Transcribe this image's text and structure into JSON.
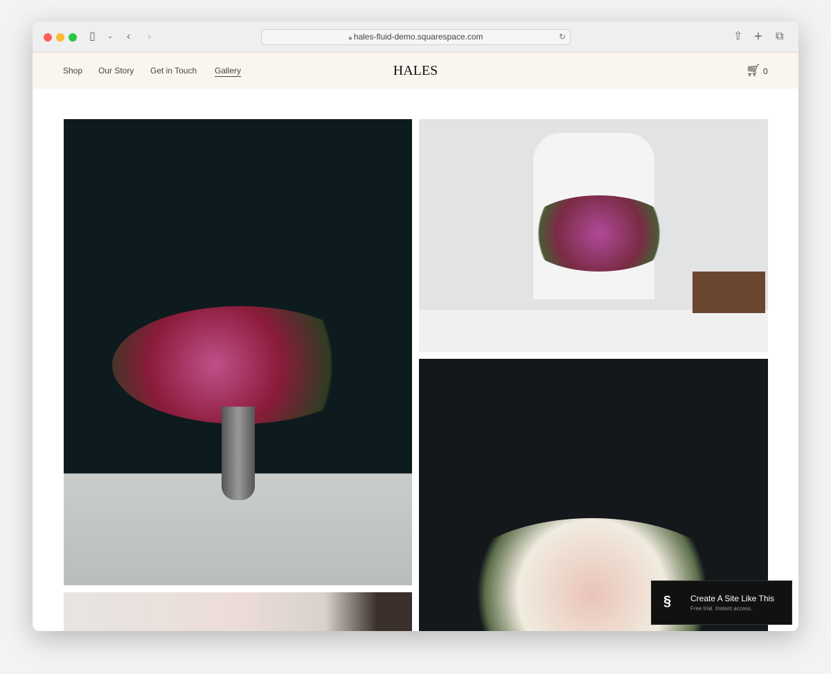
{
  "browser": {
    "url": "hales-fluid-demo.squarespace.com"
  },
  "nav": {
    "links": [
      "Shop",
      "Our Story",
      "Get in Touch",
      "Gallery"
    ],
    "active": "Gallery",
    "logo": "HALES",
    "cart_count": "0"
  },
  "banner": {
    "title": "Create A Site Like This",
    "subtitle": "Free trial. Instant access."
  },
  "colors": {
    "nav_bg": "#faf6ef",
    "accent": "#111111"
  }
}
